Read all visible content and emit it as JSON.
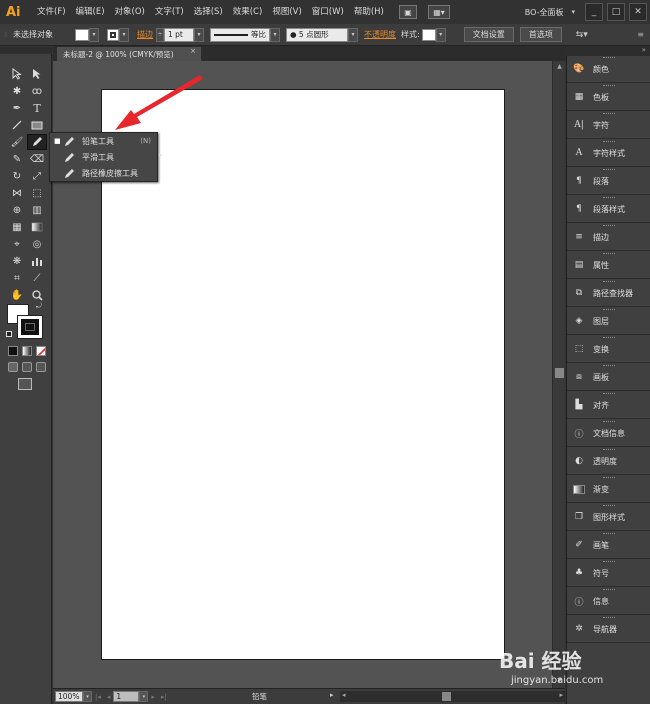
{
  "app": {
    "logo": "Ai",
    "menu": [
      "文件(F)",
      "编辑(E)",
      "对象(O)",
      "文字(T)",
      "选择(S)",
      "效果(C)",
      "视图(V)",
      "窗口(W)",
      "帮助(H)"
    ],
    "workspace": "BO-全面板",
    "window_buttons": [
      "_",
      "□",
      "✕"
    ]
  },
  "controlbar": {
    "selection": "未选择对象",
    "stroke_label": "描边",
    "stroke_weight": "1 pt",
    "stroke_profile": "等比",
    "brush": "● 5 点圆形",
    "opacity_label": "不透明度",
    "style_label": "样式:",
    "doc_setup": "文档设置",
    "preferences": "首选项"
  },
  "document": {
    "tab_title": "未标题-2 @ 100% (CMYK/预览)",
    "tab_close": "×"
  },
  "flyout": {
    "items": [
      {
        "label": "铅笔工具",
        "shortcut": "(N)",
        "active": true
      },
      {
        "label": "平滑工具",
        "shortcut": ""
      },
      {
        "label": "路径橡皮擦工具",
        "shortcut": ""
      }
    ]
  },
  "statusbar": {
    "zoom": "100%",
    "page": "1",
    "tool_name": "铅笔"
  },
  "panels": [
    {
      "label": "颜色",
      "icon": "palette-icon"
    },
    {
      "label": "色板",
      "icon": "swatches-icon"
    },
    {
      "label": "字符",
      "icon": "character-icon"
    },
    {
      "label": "字符样式",
      "icon": "character-style-icon"
    },
    {
      "label": "段落",
      "icon": "paragraph-icon"
    },
    {
      "label": "段落样式",
      "icon": "paragraph-style-icon"
    },
    {
      "label": "描边",
      "icon": "stroke-icon"
    },
    {
      "label": "属性",
      "icon": "attributes-icon"
    },
    {
      "label": "路径查找器",
      "icon": "pathfinder-icon"
    },
    {
      "label": "图层",
      "icon": "layers-icon"
    },
    {
      "label": "变换",
      "icon": "transform-icon"
    },
    {
      "label": "画板",
      "icon": "artboards-icon"
    },
    {
      "label": "对齐",
      "icon": "align-icon"
    },
    {
      "label": "文档信息",
      "icon": "document-info-icon"
    },
    {
      "label": "透明度",
      "icon": "transparency-icon"
    },
    {
      "label": "渐变",
      "icon": "gradient-icon"
    },
    {
      "label": "图形样式",
      "icon": "graphic-styles-icon"
    },
    {
      "label": "画笔",
      "icon": "brushes-icon"
    },
    {
      "label": "符号",
      "icon": "symbols-icon"
    },
    {
      "label": "信息",
      "icon": "info-icon"
    },
    {
      "label": "导航器",
      "icon": "navigator-icon"
    }
  ],
  "watermark": {
    "brand": "Bai 经验",
    "url": "jingyan.baidu.com"
  },
  "colors": {
    "accent": "#f7a21b",
    "annotation_arrow": "#e8262b"
  }
}
